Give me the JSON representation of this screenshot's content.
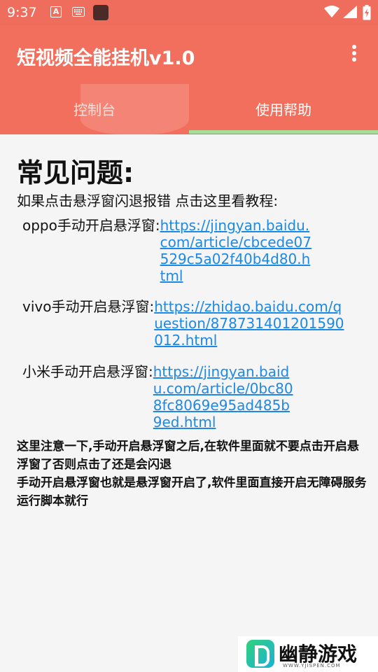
{
  "status_bar": {
    "time": "9:37",
    "a_label": "A",
    "icons": [
      "a-icon",
      "keyboard-icon",
      "app-square-icon",
      "wifi-icon",
      "signal-icon",
      "battery-charging-icon"
    ]
  },
  "app_bar": {
    "title": "短视频全能挂机v1.0",
    "menu_icon": "more-vert-icon",
    "color": "#f26f5d"
  },
  "tabs": [
    {
      "label": "控制台"
    },
    {
      "label": "使用帮助",
      "selected": true
    }
  ],
  "indicator_color": "#a9dc99",
  "content": {
    "heading": "常见问题:",
    "intro": "如果点击悬浮窗闪退报错 点击这里看教程:",
    "entries": [
      {
        "label": "oppo手动开启悬浮窗:",
        "link": "https://jingyan.baidu.com/article/cbcede07529c5a02f40b4d80.html"
      },
      {
        "label": "vivo手动开启悬浮窗:",
        "link": "https://zhidao.baidu.com/question/878731401201590012.html"
      },
      {
        "label": "小米手动开启悬浮窗:",
        "link": "https://jingyan.baidu.com/article/0bc808fc8069e95ad485b9ed.html"
      }
    ],
    "notes": [
      "这里注意一下,手动开启悬浮窗之后,在软件里面就不要点击开启悬浮窗了否则点击了还是会闪退",
      "手动开启悬浮窗也就是悬浮窗开启了,软件里面直接开启无障碍服务运行脚本就行"
    ],
    "link_color": "#1e88e5"
  },
  "watermark": {
    "text": "幽静游戏",
    "sub": "WWW.YJISPEN.COM"
  }
}
